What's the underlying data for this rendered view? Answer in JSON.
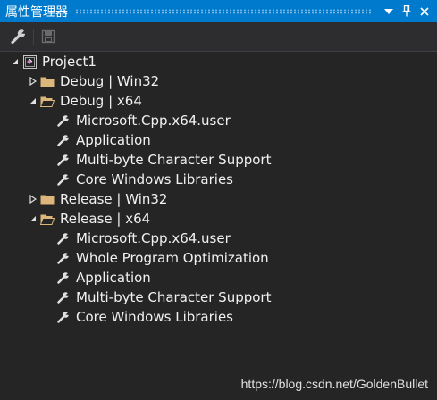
{
  "window": {
    "title": "属性管理器",
    "dropdown_icon": "dropdown-arrow-icon",
    "pin_icon": "pin-icon",
    "close_icon": "close-icon",
    "title_color": "#007acc"
  },
  "toolbar": {
    "buttons": [
      {
        "icon": "wrench-icon",
        "enabled": true
      },
      {
        "icon": "save-icon",
        "enabled": false
      }
    ]
  },
  "tree": {
    "root": {
      "label": "Project1",
      "icon": "project-icon",
      "expanded": true
    },
    "items": [
      {
        "label": "Debug | Win32",
        "icon": "folder-icon",
        "expanded": false
      },
      {
        "label": "Debug | x64",
        "icon": "folder-open-icon",
        "expanded": true,
        "children": [
          {
            "label": "Microsoft.Cpp.x64.user",
            "icon": "wrench-icon"
          },
          {
            "label": "Application",
            "icon": "wrench-icon"
          },
          {
            "label": "Multi-byte Character Support",
            "icon": "wrench-icon"
          },
          {
            "label": "Core Windows Libraries",
            "icon": "wrench-icon"
          }
        ]
      },
      {
        "label": "Release | Win32",
        "icon": "folder-icon",
        "expanded": false
      },
      {
        "label": "Release | x64",
        "icon": "folder-open-icon",
        "expanded": true,
        "children": [
          {
            "label": "Microsoft.Cpp.x64.user",
            "icon": "wrench-icon"
          },
          {
            "label": "Whole Program Optimization",
            "icon": "wrench-icon"
          },
          {
            "label": "Application",
            "icon": "wrench-icon"
          },
          {
            "label": "Multi-byte Character Support",
            "icon": "wrench-icon"
          },
          {
            "label": "Core Windows Libraries",
            "icon": "wrench-icon"
          }
        ]
      }
    ]
  },
  "watermark": "https://blog.csdn.net/GoldenBullet"
}
